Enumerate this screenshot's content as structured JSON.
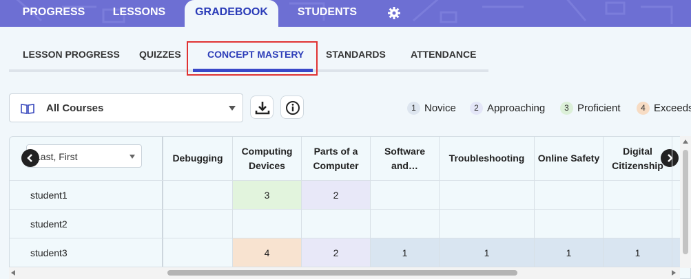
{
  "top_tabs": [
    {
      "label": "PROGRESS",
      "active": false
    },
    {
      "label": "LESSONS",
      "active": false
    },
    {
      "label": "GRADEBOOK",
      "active": true
    },
    {
      "label": "STUDENTS",
      "active": false
    }
  ],
  "sub_tabs": [
    {
      "label": "LESSON PROGRESS",
      "active": false
    },
    {
      "label": "QUIZZES",
      "active": false
    },
    {
      "label": "CONCEPT MASTERY",
      "active": true
    },
    {
      "label": "STANDARDS",
      "active": false
    },
    {
      "label": "ATTENDANCE",
      "active": false
    }
  ],
  "course_filter": {
    "value": "All Courses"
  },
  "legend": [
    {
      "num": "1",
      "label": "Novice",
      "color": "#dde5ef"
    },
    {
      "num": "2",
      "label": "Approaching",
      "color": "#e4e6f8"
    },
    {
      "num": "3",
      "label": "Proficient",
      "color": "#dcf0d8"
    },
    {
      "num": "4",
      "label": "Exceeds",
      "color": "#f7dcc4"
    }
  ],
  "table": {
    "name_sort": "Last, First",
    "columns": [
      "Debugging",
      "Computing Devices",
      "Parts of a Computer",
      "Software and…",
      "Troubleshooting",
      "Online Safety",
      "Digital Citizenship"
    ],
    "rows": [
      {
        "name": "student1",
        "cells": [
          "",
          "3",
          "2",
          "",
          "",
          "",
          ""
        ]
      },
      {
        "name": "student2",
        "cells": [
          "",
          "",
          "",
          "",
          "",
          "",
          ""
        ]
      },
      {
        "name": "student3",
        "cells": [
          "",
          "4",
          "2",
          "1",
          "1",
          "1",
          "1"
        ]
      }
    ]
  },
  "colors": {
    "nav": "#6d6fd3",
    "accent": "#2b3cb8",
    "highlight_border": "#e03232",
    "level_1": "#d9e5f1",
    "level_2": "#e8e8f8",
    "level_3": "#e2f4dd",
    "level_4": "#f8e3d0"
  }
}
